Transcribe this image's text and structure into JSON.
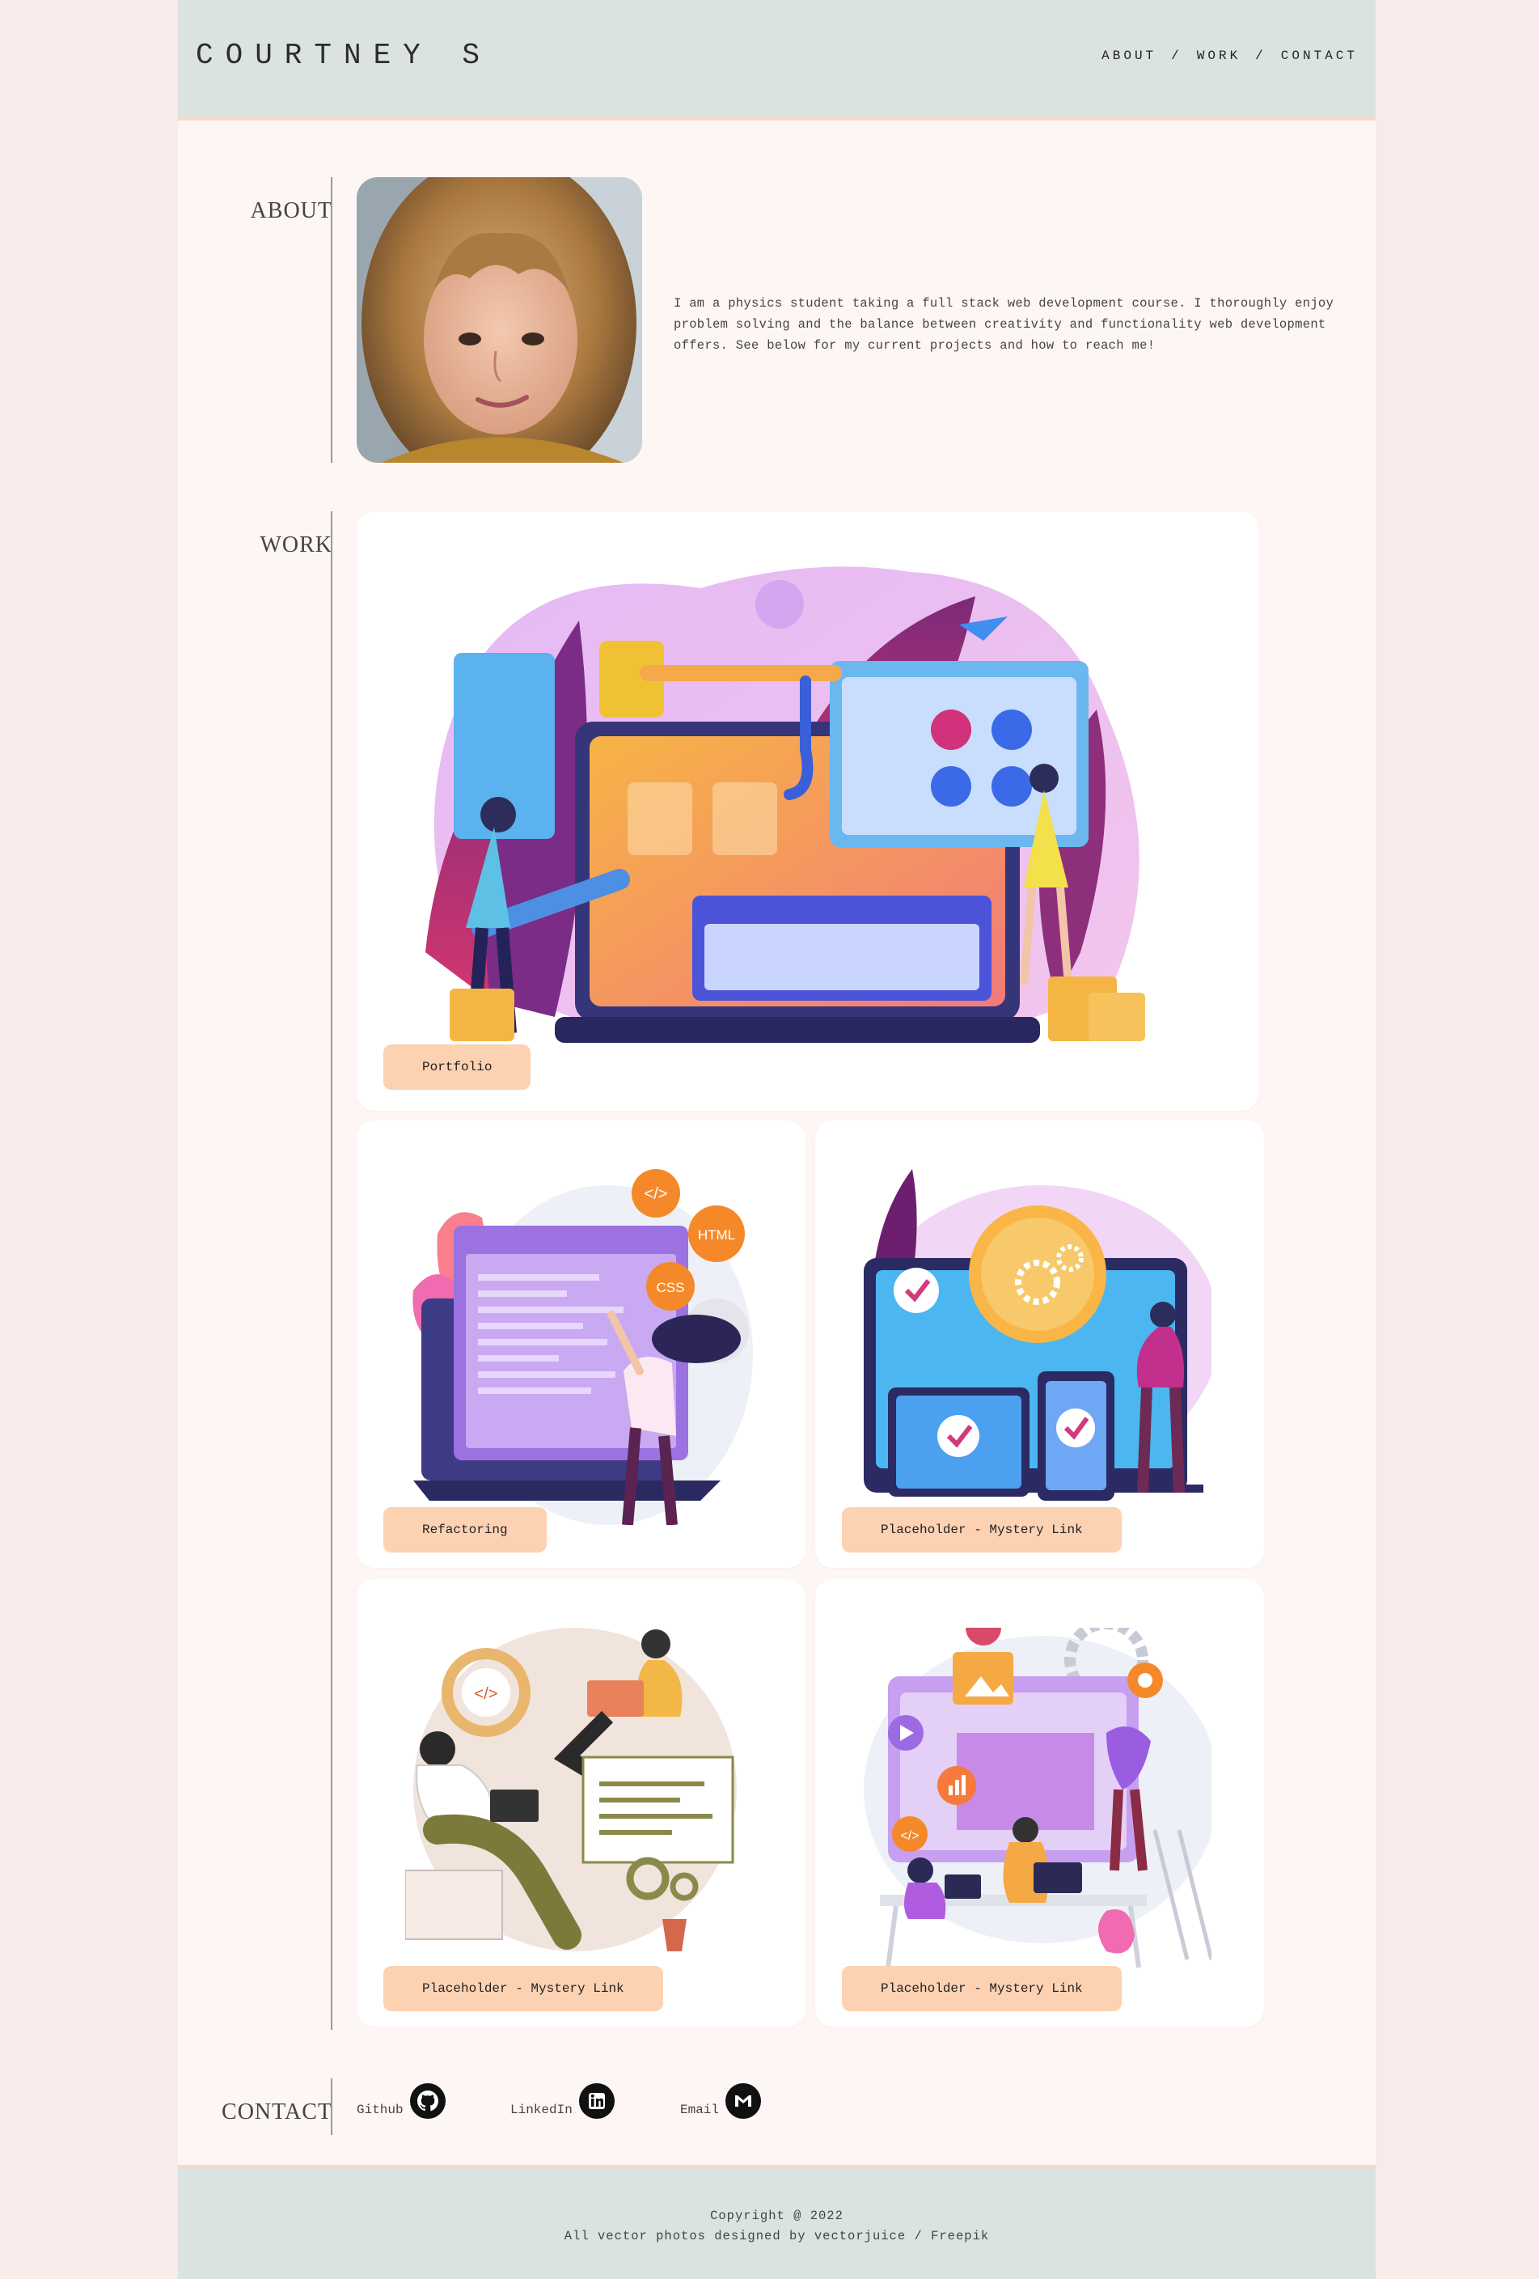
{
  "header": {
    "brand": "COURTNEY S",
    "nav": [
      {
        "label": "ABOUT"
      },
      {
        "label": "WORK"
      },
      {
        "label": "CONTACT"
      }
    ],
    "separator": "/"
  },
  "about": {
    "heading": "ABOUT",
    "bio": "I am a physics student taking a full stack web development course. I thoroughly enjoy problem solving and the balance between creativity and functionality web development offers. See below for my current projects and how to reach me!"
  },
  "work": {
    "heading": "WORK",
    "projects": [
      {
        "label": "Portfolio"
      },
      {
        "label": "Refactoring"
      },
      {
        "label": "Placeholder - Mystery Link"
      },
      {
        "label": "Placeholder - Mystery Link"
      },
      {
        "label": "Placeholder - Mystery Link"
      }
    ]
  },
  "contact": {
    "heading": "CONTACT",
    "links": [
      {
        "label": "Github",
        "icon": "github-icon"
      },
      {
        "label": "LinkedIn",
        "icon": "linkedin-icon"
      },
      {
        "label": "Email",
        "icon": "gmail-icon"
      }
    ]
  },
  "footer": {
    "copyright": "Copyright @ 2022",
    "credits": "All vector photos designed by vectorjuice / Freepik"
  },
  "colors": {
    "header_bg": "#dae3df",
    "page_bg": "#fdf6f4",
    "outer_bg": "#f9ebea",
    "pill_bg": "#fcd2b3",
    "accent_border": "#f9d9c0"
  }
}
